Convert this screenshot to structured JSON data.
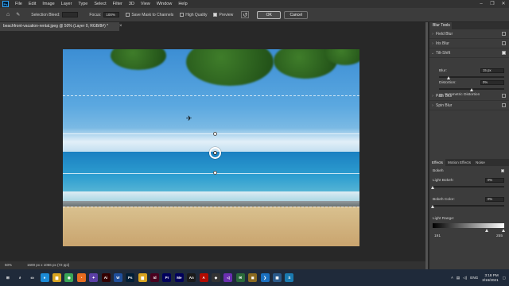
{
  "menubar": {
    "logo": "Ps",
    "items": [
      "File",
      "Edit",
      "Image",
      "Layer",
      "Type",
      "Select",
      "Filter",
      "3D",
      "View",
      "Window",
      "Help"
    ],
    "window_controls": [
      "–",
      "❐",
      "✕"
    ]
  },
  "options": {
    "selection_bleed_label": "Selection Bleed:",
    "selection_bleed_value": "",
    "focus_label": "Focus:",
    "focus_value": "100%",
    "save_mask_label": "Save Mask to Channels",
    "save_mask_checked": false,
    "high_quality_label": "High Quality",
    "high_quality_checked": false,
    "preview_label": "Preview",
    "preview_checked": true,
    "ok_label": "OK",
    "cancel_label": "Cancel"
  },
  "document": {
    "tab_title": "beachfront-vacation-rental.jpeg @ 50% (Layer 0, RGB/8#) *",
    "close_glyph": "×"
  },
  "status": {
    "zoom": "50%",
    "info": "1600 px x 1066 px (72 ppi)"
  },
  "blur_tools": {
    "panel_title": "Blur Tools",
    "items": [
      {
        "label": "Field Blur",
        "expanded": false,
        "checked": false
      },
      {
        "label": "Iris Blur",
        "expanded": false,
        "checked": false
      },
      {
        "label": "Tilt-Shift",
        "expanded": true,
        "checked": true
      },
      {
        "label": "Path Blur",
        "expanded": false,
        "checked": false
      },
      {
        "label": "Spin Blur",
        "expanded": false,
        "checked": false
      }
    ],
    "tilt_shift": {
      "blur_label": "Blur:",
      "blur_value": "15 px",
      "blur_level": 0.15,
      "distortion_label": "Distortion:",
      "distortion_value": "0%",
      "distortion_level": 0.5,
      "symmetric_label": "Symmetric Distortion",
      "symmetric_checked": false
    }
  },
  "effects": {
    "tabs": [
      "Effects",
      "Motion Effects",
      "Noise"
    ],
    "active_tab": "Effects",
    "bokeh_label": "Bokeh",
    "bokeh_checked": true,
    "light_bokeh_label": "Light Bokeh:",
    "light_bokeh_value": "0%",
    "light_bokeh_level": 0,
    "bokeh_color_label": "Bokeh Color:",
    "bokeh_color_value": "0%",
    "bokeh_color_level": 0,
    "light_range_label": "Light Range:",
    "light_range_min": "191",
    "light_range_max": "255"
  },
  "taskbar": {
    "apps": [
      {
        "icon": "windows-start-icon",
        "glyph": "⊞",
        "color": "#1f2a3a"
      },
      {
        "icon": "search-icon",
        "glyph": "⌕",
        "color": "#1f2a3a"
      },
      {
        "icon": "task-view-icon",
        "glyph": "▭",
        "color": "#1f2a3a"
      },
      {
        "icon": "edge-icon",
        "glyph": "e",
        "color": "#1b8ad6"
      },
      {
        "icon": "explorer-icon",
        "glyph": "▆",
        "color": "#d9a520"
      },
      {
        "icon": "chrome-icon",
        "glyph": "◉",
        "color": "#3aa757"
      },
      {
        "icon": "firefox-icon",
        "glyph": "◔",
        "color": "#e76c1f"
      },
      {
        "icon": "app-icon",
        "glyph": "✦",
        "color": "#5b3fa6"
      },
      {
        "icon": "illustrator-icon",
        "glyph": "Ai",
        "color": "#330000"
      },
      {
        "icon": "word-icon",
        "glyph": "W",
        "color": "#1f4f9c"
      },
      {
        "icon": "photoshop-icon",
        "glyph": "Ps",
        "color": "#001e36"
      },
      {
        "icon": "explorer-icon",
        "glyph": "▆",
        "color": "#d9a520"
      },
      {
        "icon": "indesign-icon",
        "glyph": "Id",
        "color": "#49021f"
      },
      {
        "icon": "premiere-icon",
        "glyph": "Pr",
        "color": "#00005b"
      },
      {
        "icon": "media-encoder-icon",
        "glyph": "Me",
        "color": "#00005b"
      },
      {
        "icon": "animate-icon",
        "glyph": "An",
        "color": "#1b1b1b"
      },
      {
        "icon": "acrobat-icon",
        "glyph": "A",
        "color": "#b30b00"
      },
      {
        "icon": "app-icon",
        "glyph": "◆",
        "color": "#333333"
      },
      {
        "icon": "visual-studio-icon",
        "glyph": "◁",
        "color": "#6a2fb0"
      },
      {
        "icon": "chat-icon",
        "glyph": "✉",
        "color": "#2a6a3a"
      },
      {
        "icon": "app-icon",
        "glyph": "◼",
        "color": "#8a6a20"
      },
      {
        "icon": "vscode-icon",
        "glyph": "❯",
        "color": "#1a70c0"
      },
      {
        "icon": "app-icon",
        "glyph": "▦",
        "color": "#2a5a8a"
      },
      {
        "icon": "app-icon",
        "glyph": "S",
        "color": "#1a7ab0"
      }
    ],
    "lang": "ENG",
    "time": "3:18 PM",
    "date": "3/16/2021"
  }
}
